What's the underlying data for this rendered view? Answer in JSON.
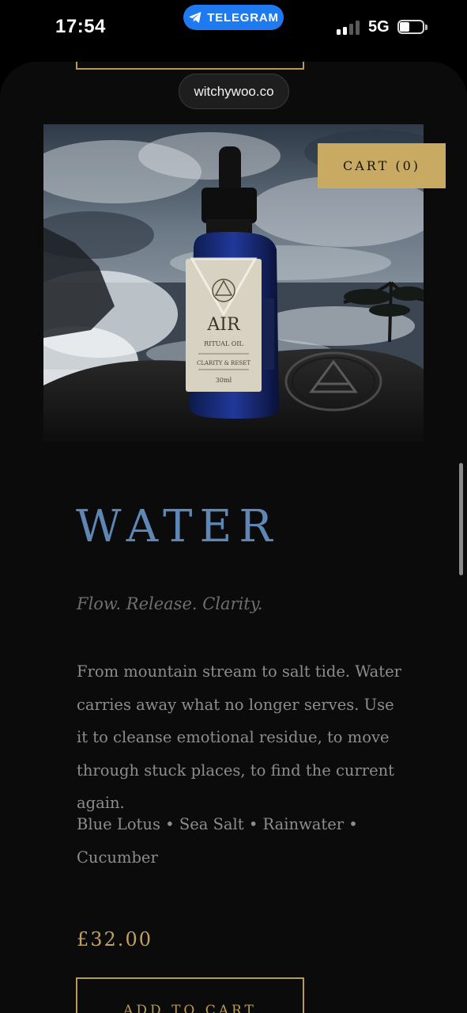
{
  "status_bar": {
    "time": "17:54",
    "telegram_label": "TELEGRAM",
    "network": "5G"
  },
  "browser": {
    "url": "witchywoo.co"
  },
  "header": {
    "cart_label": "CART (0)"
  },
  "product_image": {
    "bottle_name": "AIR",
    "bottle_subtitle": "RITUAL OIL",
    "bottle_tag": "CLARITY & RESET",
    "bottle_volume": "30ml"
  },
  "product": {
    "title": "WATER",
    "tagline": "Flow. Release. Clarity.",
    "description": "From mountain stream to salt tide. Water carries away what no longer serves. Use it to cleanse emotional residue, to move through stuck places, to find the current again.",
    "ingredients": "Blue Lotus • Sea Salt • Rainwater • Cucumber",
    "price": "£32.00",
    "add_to_cart_label": "ADD TO CART"
  },
  "colors": {
    "title_blue": "#5f87b6",
    "gold": "#c8aa62",
    "page_bg": "#0b0b0b",
    "telegram_blue": "#1f7af0"
  }
}
